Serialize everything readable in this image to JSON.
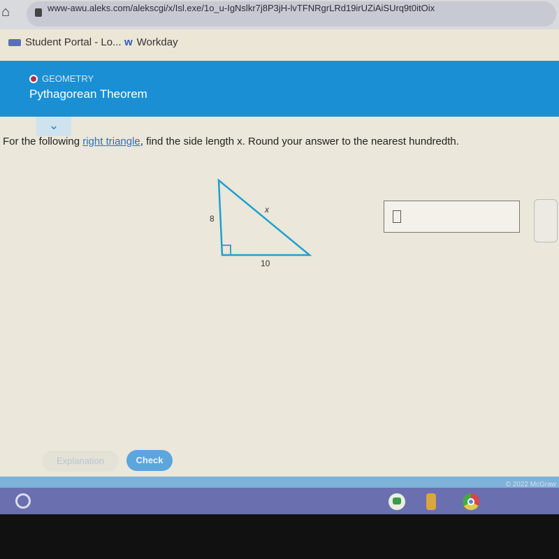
{
  "browser": {
    "url": "www-awu.aleks.com/alekscgi/x/Isl.exe/1o_u-IgNslkr7j8P3jH-lvTFNRgrLRd19irUZiAiSUrq9t0itOix",
    "icons": [
      "home-icon",
      "lock-icon"
    ]
  },
  "bookmarks": [
    {
      "label": "Student Portal - Lo...",
      "icon": "portal-icon"
    },
    {
      "label": "Workday",
      "icon": "workday-icon"
    }
  ],
  "header": {
    "topic": "GEOMETRY",
    "title": "Pythagorean Theorem",
    "color": "#1a8fd4"
  },
  "question": {
    "prefix": "For the following ",
    "link": "right triangle",
    "suffix": ", find the side length x. Round your answer to the nearest hundredth."
  },
  "triangle": {
    "leg_vertical": "8",
    "leg_horizontal": "10",
    "hypotenuse": "x"
  },
  "answer": {
    "value": ""
  },
  "buttons": {
    "explanation": "Explanation",
    "check": "Check"
  },
  "footer": {
    "copyright": "© 2022 McGraw"
  },
  "taskbar": {
    "apps": [
      "launcher-icon",
      "messages-icon",
      "files-icon",
      "chrome-icon"
    ]
  }
}
